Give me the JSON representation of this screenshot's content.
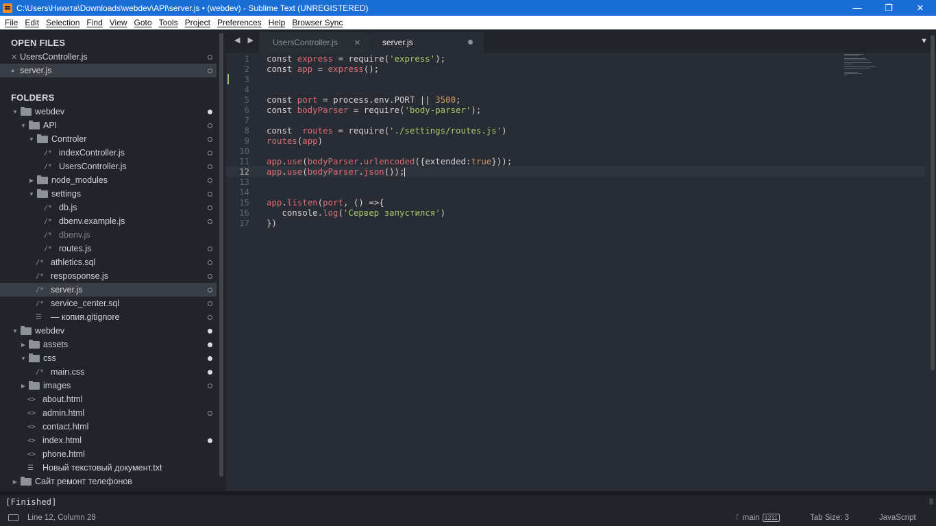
{
  "window": {
    "title": "C:\\Users\\Никита\\Downloads\\webdev\\API\\server.js • (webdev) - Sublime Text (UNREGISTERED)",
    "minimize": "—",
    "maximize": "❐",
    "close": "✕"
  },
  "menu": [
    "File",
    "Edit",
    "Selection",
    "Find",
    "View",
    "Goto",
    "Tools",
    "Project",
    "Preferences",
    "Help",
    "Browser Sync"
  ],
  "sidebar": {
    "open_files_heading": "OPEN FILES",
    "open_files": [
      {
        "name": "UsersController.js",
        "marker": "✕"
      },
      {
        "name": "server.js",
        "marker": "●"
      }
    ],
    "folders_heading": "FOLDERS",
    "tree": [
      {
        "label": "webdev",
        "type": "folder",
        "expanded": true,
        "status": "filled"
      },
      {
        "label": "API",
        "type": "folder",
        "expanded": true,
        "status": "open"
      },
      {
        "label": "Controler",
        "type": "folder",
        "expanded": true,
        "status": "open"
      },
      {
        "label": "indexController.js",
        "type": "file",
        "icon": "/*",
        "status": "open"
      },
      {
        "label": "UsersController.js",
        "type": "file",
        "icon": "/*",
        "status": "open"
      },
      {
        "label": "node_modules",
        "type": "folder",
        "expanded": false,
        "status": "open"
      },
      {
        "label": "settings",
        "type": "folder",
        "expanded": true,
        "status": "open"
      },
      {
        "label": "db.js",
        "type": "file",
        "icon": "/*",
        "status": "open"
      },
      {
        "label": "dbenv.example.js",
        "type": "file",
        "icon": "/*",
        "status": "open"
      },
      {
        "label": "dbenv.js",
        "type": "file",
        "icon": "/*",
        "status": "none",
        "dim": true
      },
      {
        "label": "routes.js",
        "type": "file",
        "icon": "/*",
        "status": "open"
      },
      {
        "label": "athletics.sql",
        "type": "file",
        "icon": "/*",
        "status": "open"
      },
      {
        "label": "resposponse.js",
        "type": "file",
        "icon": "/*",
        "status": "open"
      },
      {
        "label": "server.js",
        "type": "file",
        "icon": "/*",
        "status": "open",
        "selected": true
      },
      {
        "label": "service_center.sql",
        "type": "file",
        "icon": "/*",
        "status": "open"
      },
      {
        "label": "— копия.gitignore",
        "type": "file",
        "icon": "☰",
        "status": "open"
      },
      {
        "label": "webdev",
        "type": "folder",
        "expanded": true,
        "status": "filled"
      },
      {
        "label": "assets",
        "type": "folder",
        "expanded": false,
        "status": "filled"
      },
      {
        "label": "css",
        "type": "folder",
        "expanded": true,
        "status": "filled"
      },
      {
        "label": "main.css",
        "type": "file",
        "icon": "/*",
        "status": "filled"
      },
      {
        "label": "images",
        "type": "folder",
        "expanded": false,
        "status": "open"
      },
      {
        "label": "about.html",
        "type": "file",
        "icon": "<>",
        "status": "none"
      },
      {
        "label": "admin.html",
        "type": "file",
        "icon": "<>",
        "status": "open"
      },
      {
        "label": "contact.html",
        "type": "file",
        "icon": "<>",
        "status": "none"
      },
      {
        "label": "index.html",
        "type": "file",
        "icon": "<>",
        "status": "filled"
      },
      {
        "label": "phone.html",
        "type": "file",
        "icon": "<>",
        "status": "none"
      },
      {
        "label": "Новый текстовый документ.txt",
        "type": "file",
        "icon": "☰",
        "status": "none"
      },
      {
        "label": "Сайт ремонт телефонов",
        "type": "folder",
        "expanded": false,
        "status": "none"
      }
    ]
  },
  "tabs": [
    {
      "label": "UsersController.js",
      "active": false,
      "marker": "✕"
    },
    {
      "label": "server.js",
      "active": true,
      "marker": "dirty"
    }
  ],
  "tab_nav": "◀ ▶",
  "tab_dropdown": "▼",
  "editor": {
    "current_line": 12,
    "modified_line": 3,
    "lines": [
      [
        [
          "kw",
          "const "
        ],
        [
          "var",
          "express"
        ],
        [
          "kw",
          " = "
        ],
        [
          "kw",
          "require("
        ],
        [
          "str",
          "'express'"
        ],
        [
          "kw",
          ");"
        ]
      ],
      [
        [
          "kw",
          "const "
        ],
        [
          "var",
          "app"
        ],
        [
          "kw",
          " = "
        ],
        [
          "fn",
          "express"
        ],
        [
          "kw",
          "();"
        ]
      ],
      [],
      [],
      [
        [
          "kw",
          "const "
        ],
        [
          "var",
          "port"
        ],
        [
          "kw",
          " = process.env.PORT || "
        ],
        [
          "num",
          "3500"
        ],
        [
          "kw",
          ";"
        ]
      ],
      [
        [
          "kw",
          "const "
        ],
        [
          "var",
          "bodyParser"
        ],
        [
          "kw",
          " = require("
        ],
        [
          "str",
          "'body-parser'"
        ],
        [
          "kw",
          ");"
        ]
      ],
      [],
      [
        [
          "kw",
          "const  "
        ],
        [
          "var",
          "routes"
        ],
        [
          "kw",
          " = require("
        ],
        [
          "str",
          "'./settings/routes.js'"
        ],
        [
          "kw",
          ")"
        ]
      ],
      [
        [
          "fn",
          "routes"
        ],
        [
          "kw",
          "("
        ],
        [
          "var",
          "app"
        ],
        [
          "kw",
          ")"
        ]
      ],
      [],
      [
        [
          "var",
          "app"
        ],
        [
          "kw",
          "."
        ],
        [
          "fn",
          "use"
        ],
        [
          "kw",
          "("
        ],
        [
          "var",
          "bodyParser"
        ],
        [
          "kw",
          "."
        ],
        [
          "fn",
          "urlencoded"
        ],
        [
          "kw",
          "({extended:"
        ],
        [
          "bool",
          "true"
        ],
        [
          "kw",
          "}));"
        ]
      ],
      [
        [
          "var",
          "app"
        ],
        [
          "kw",
          "."
        ],
        [
          "fn",
          "use"
        ],
        [
          "kw",
          "("
        ],
        [
          "var",
          "bodyParser"
        ],
        [
          "kw",
          "."
        ],
        [
          "fn",
          "json"
        ],
        [
          "kw",
          "());"
        ]
      ],
      [],
      [],
      [
        [
          "var",
          "app"
        ],
        [
          "kw",
          "."
        ],
        [
          "fn",
          "listen"
        ],
        [
          "kw",
          "("
        ],
        [
          "var",
          "port"
        ],
        [
          "kw",
          ", () =>{"
        ]
      ],
      [
        [
          "kw",
          "   console."
        ],
        [
          "fn",
          "log"
        ],
        [
          "kw",
          "("
        ],
        [
          "str",
          "'Сервер запустился'"
        ],
        [
          "kw",
          ")"
        ]
      ],
      [
        [
          "kw",
          "})"
        ]
      ]
    ]
  },
  "output": {
    "text": "[Finished]"
  },
  "status": {
    "position": "Line 12, Column 28",
    "branch": "main",
    "badge": "1211",
    "tab_size": "Tab Size: 3",
    "syntax": "JavaScript"
  }
}
